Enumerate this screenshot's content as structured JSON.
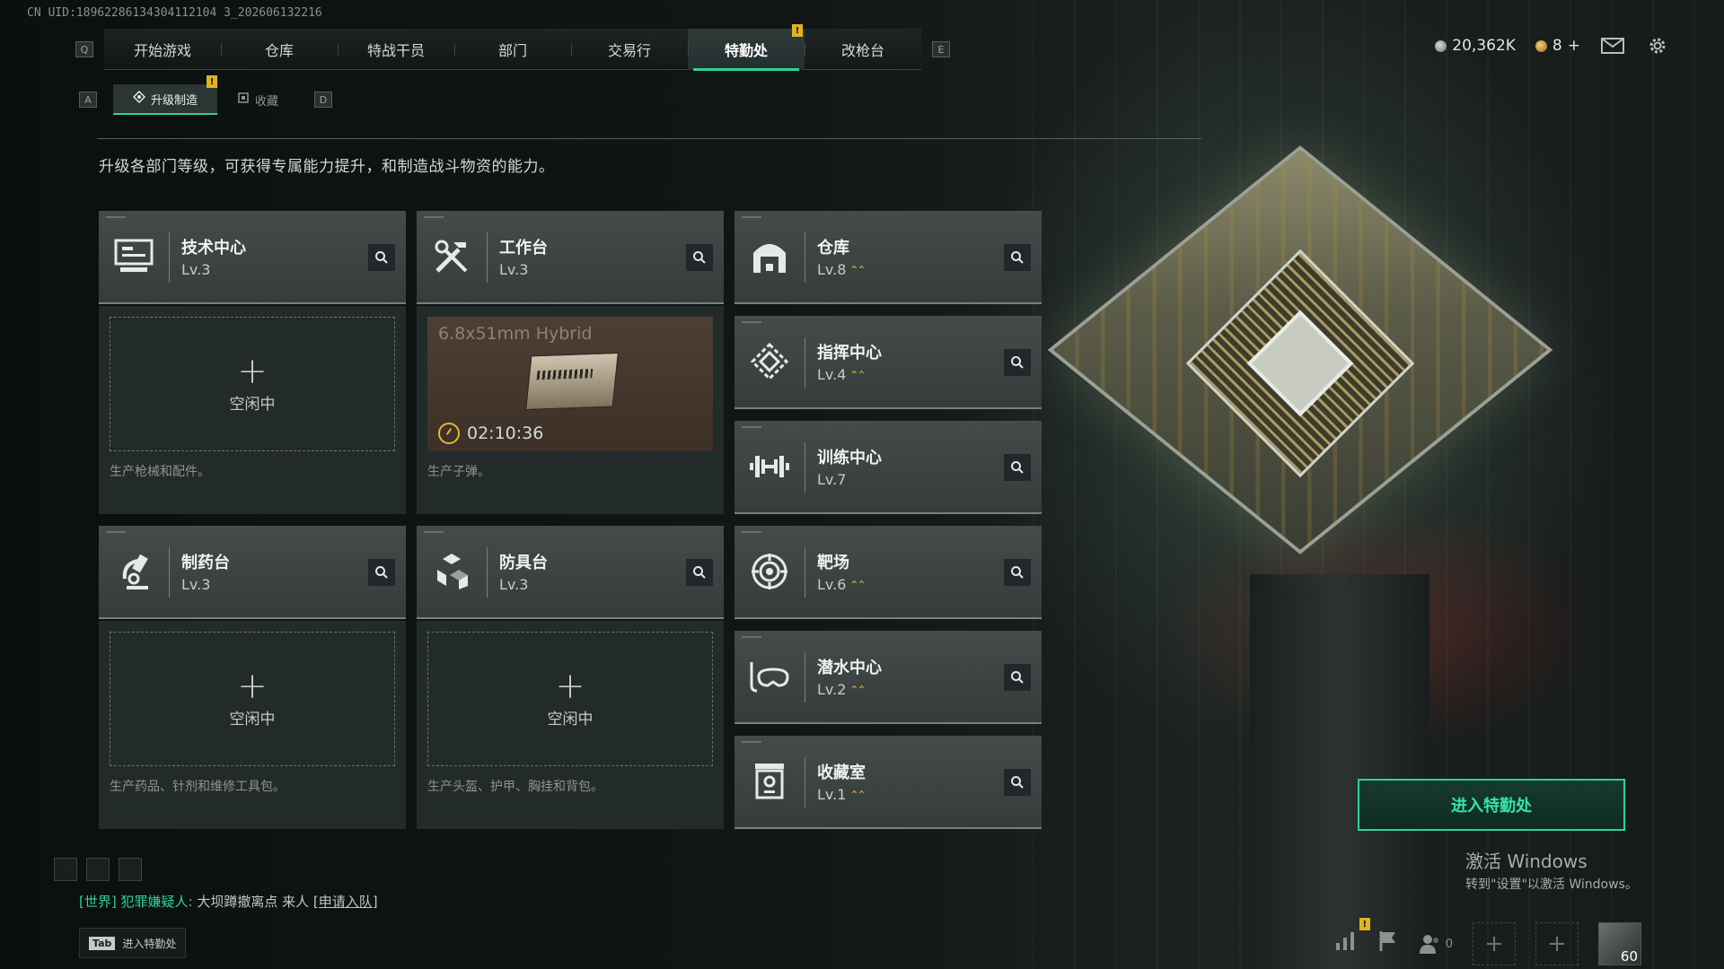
{
  "uid": "CN UID:18962286134304112104 3_202606132216",
  "nav": {
    "left_key": "Q",
    "right_key": "E",
    "tabs": [
      {
        "label": "开始游戏"
      },
      {
        "label": "仓库"
      },
      {
        "label": "特战干员"
      },
      {
        "label": "部门"
      },
      {
        "label": "交易行"
      },
      {
        "label": "特勤处",
        "active": true,
        "badge": "!"
      },
      {
        "label": "改枪台"
      }
    ]
  },
  "currency": {
    "silver": "20,362K",
    "gold": "8",
    "gold_add": "+"
  },
  "subnav": {
    "left_key": "A",
    "right_key": "D",
    "tabs": [
      {
        "label": "升级制造",
        "active": true,
        "badge": "!"
      },
      {
        "label": "收藏"
      }
    ]
  },
  "description": "升级各部门等级，可获得专属能力提升，和制造战斗物资的能力。",
  "workbenches": [
    {
      "name": "技术中心",
      "level": "Lv.3",
      "icon": "computer-icon",
      "status": "空闲中",
      "idle_plus": "+",
      "note": "生产枪械和配件。"
    },
    {
      "name": "工作台",
      "level": "Lv.3",
      "icon": "tools-icon",
      "production": {
        "item": "6.8x51mm Hybrid",
        "timer": "02:10:36"
      },
      "note": "生产子弹。"
    },
    {
      "name": "制药台",
      "level": "Lv.3",
      "icon": "microscope-icon",
      "status": "空闲中",
      "idle_plus": "+",
      "note": "生产药品、针剂和维修工具包。"
    },
    {
      "name": "防具台",
      "level": "Lv.3",
      "icon": "armor-blocks-icon",
      "status": "空闲中",
      "idle_plus": "+",
      "note": "生产头盔、护甲、胸挂和背包。"
    }
  ],
  "departments": [
    {
      "name": "仓库",
      "level": "Lv.8",
      "upgradable": true,
      "icon": "warehouse-icon"
    },
    {
      "name": "指挥中心",
      "level": "Lv.4",
      "upgradable": true,
      "icon": "command-icon"
    },
    {
      "name": "训练中心",
      "level": "Lv.7",
      "upgradable": false,
      "icon": "dumbbell-icon"
    },
    {
      "name": "靶场",
      "level": "Lv.6",
      "upgradable": true,
      "icon": "target-icon"
    },
    {
      "name": "潜水中心",
      "level": "Lv.2",
      "upgradable": true,
      "icon": "diving-mask-icon"
    },
    {
      "name": "收藏室",
      "level": "Lv.1",
      "upgradable": true,
      "icon": "vault-icon"
    }
  ],
  "enter_button": "进入特勤处",
  "activation": {
    "title": "激活 Windows",
    "subtitle": "转到\"设置\"以激活 Windows。"
  },
  "chat": {
    "channel": "[世界]",
    "sender": "犯罪嫌疑人:",
    "message": "大坝蹲撤离点 来人",
    "action": "[申请入队]"
  },
  "tab_hint": {
    "key": "Tab",
    "label": "进入特勤处"
  },
  "bottom": {
    "friends_count": "0",
    "level": "60",
    "badge": "!"
  },
  "colors": {
    "accent": "#2fd19a",
    "upgrade": "#e0b530",
    "badge": "#e2b321"
  }
}
